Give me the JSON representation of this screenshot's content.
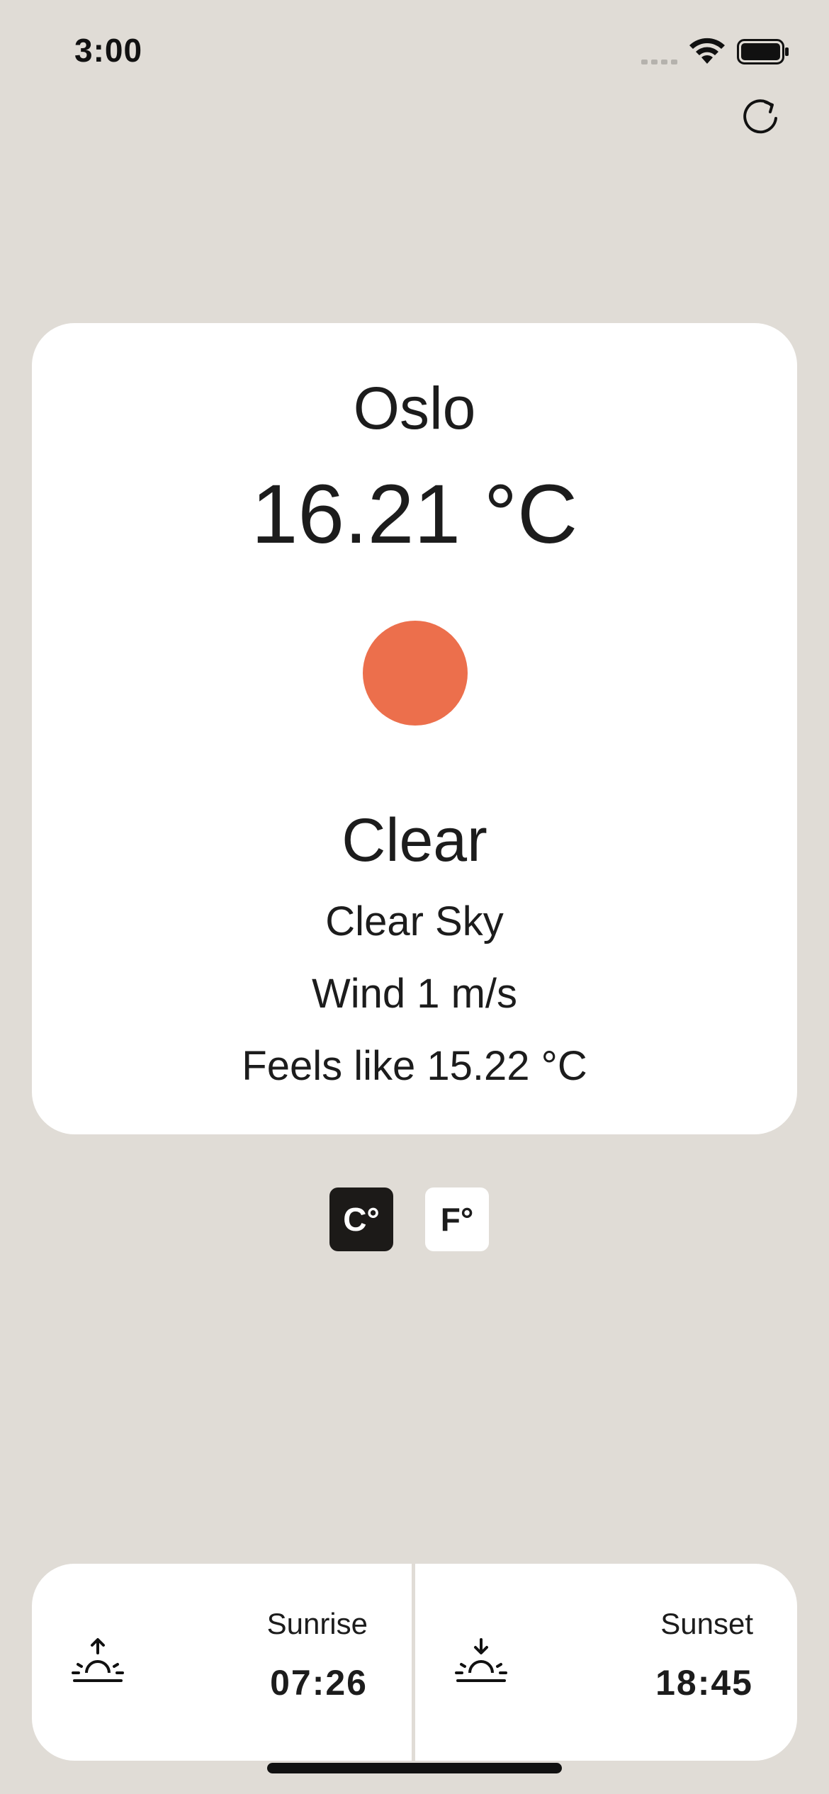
{
  "status_bar": {
    "time": "3:00",
    "signal_icon": "cellular-signal-icon",
    "wifi_icon": "wifi-icon",
    "battery_icon": "battery-icon"
  },
  "toolbar": {
    "refresh_icon": "refresh-icon"
  },
  "weather": {
    "city": "Oslo",
    "temperature": "16.21 °C",
    "condition_icon": "sun-icon",
    "condition_color": "#ec6f4c",
    "condition": "Clear",
    "description": "Clear Sky",
    "wind": "Wind 1 m/s",
    "feels_like": "Feels like 15.22 °C"
  },
  "units": {
    "celsius_label": "C°",
    "fahrenheit_label": "F°",
    "selected": "celsius"
  },
  "sun": {
    "sunrise_label": "Sunrise",
    "sunrise_time": "07:26",
    "sunrise_icon": "sunrise-icon",
    "sunset_label": "Sunset",
    "sunset_time": "18:45",
    "sunset_icon": "sunset-icon"
  },
  "colors": {
    "background": "#e0dcd6",
    "card": "#ffffff",
    "accent_selected": "#1c1a18",
    "sun": "#ec6f4c"
  }
}
